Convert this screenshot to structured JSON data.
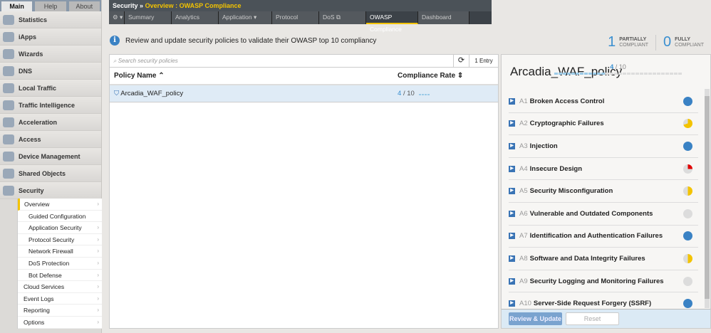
{
  "top_tabs": [
    "Main",
    "Help",
    "About"
  ],
  "nav": [
    "Statistics",
    "iApps",
    "Wizards",
    "DNS",
    "Local Traffic",
    "Traffic Intelligence",
    "Acceleration",
    "Access",
    "Device Management",
    "Shared Objects",
    "Security"
  ],
  "submenu": [
    {
      "label": "Overview",
      "indent": false,
      "chevron": true,
      "active": true
    },
    {
      "label": "Guided Configuration",
      "indent": true,
      "chevron": false
    },
    {
      "label": "Application Security",
      "indent": true,
      "chevron": true
    },
    {
      "label": "Protocol Security",
      "indent": true,
      "chevron": true
    },
    {
      "label": "Network Firewall",
      "indent": true,
      "chevron": true
    },
    {
      "label": "DoS Protection",
      "indent": true,
      "chevron": true
    },
    {
      "label": "Bot Defense",
      "indent": true,
      "chevron": true
    },
    {
      "label": "Cloud Services",
      "indent": false,
      "chevron": true
    },
    {
      "label": "Event Logs",
      "indent": false,
      "chevron": true
    },
    {
      "label": "Reporting",
      "indent": false,
      "chevron": true
    },
    {
      "label": "Options",
      "indent": false,
      "chevron": true
    }
  ],
  "breadcrumb": {
    "root": "Security",
    "sep": "»",
    "path": "Overview : OWASP Compliance"
  },
  "tabs": [
    {
      "label": "⚙ ▾",
      "w": 22
    },
    {
      "label": "Summary",
      "w": 66
    },
    {
      "label": "Analytics",
      "w": 66
    },
    {
      "label": "Application    ▾",
      "w": 75
    },
    {
      "label": "Protocol",
      "w": 66
    },
    {
      "label": "DoS            ⧉",
      "w": 66
    },
    {
      "label": "OWASP Compliance",
      "w": 73,
      "active": true
    },
    {
      "label": "Dashboard",
      "w": 72
    }
  ],
  "info": "Review and update security policies to validate their OWASP top 10 compliancy",
  "stats": {
    "partial": {
      "n": "1",
      "l1": "PARTIALLY",
      "l2": "COMPLIANT"
    },
    "full": {
      "n": "0",
      "l1": "FULLY",
      "l2": "COMPLIANT"
    }
  },
  "table": {
    "search_placeholder": "Search security policies",
    "entries": "1 Entry",
    "col_name": "Policy Name ⌃",
    "col_rate": "Compliance Rate ⇕",
    "rows": [
      {
        "name": "Arcadia_WAF_policy",
        "score": "4",
        "total": "/ 10"
      }
    ]
  },
  "detail": {
    "title": "Arcadia_WAF_policy",
    "score": "4",
    "total": " / 10",
    "items": [
      {
        "code": "A1",
        "name": "Broken Access Control",
        "fraction": 1
      },
      {
        "code": "A2",
        "name": "Cryptographic Failures",
        "fraction": 0.7
      },
      {
        "code": "A3",
        "name": "Injection",
        "fraction": 1
      },
      {
        "code": "A4",
        "name": "Insecure Design",
        "fraction": 0.25
      },
      {
        "code": "A5",
        "name": "Security Misconfiguration",
        "fraction": 0.5
      },
      {
        "code": "A6",
        "name": "Vulnerable and Outdated Components",
        "fraction": 0
      },
      {
        "code": "A7",
        "name": "Identification and Authentication Failures",
        "fraction": 1
      },
      {
        "code": "A8",
        "name": "Software and Data Integrity Failures",
        "fraction": 0.5
      },
      {
        "code": "A9",
        "name": "Security Logging and Monitoring Failures",
        "fraction": 0
      },
      {
        "code": "A10",
        "name": "Server-Side Request Forgery (SSRF)",
        "fraction": 1
      }
    ],
    "review_btn": "Review & Update",
    "reset_btn": "Reset"
  },
  "colors": {
    "full": "#3a82c4",
    "partial": "#f3c300",
    "low": "#e00000",
    "empty": "#dcdcdc"
  }
}
